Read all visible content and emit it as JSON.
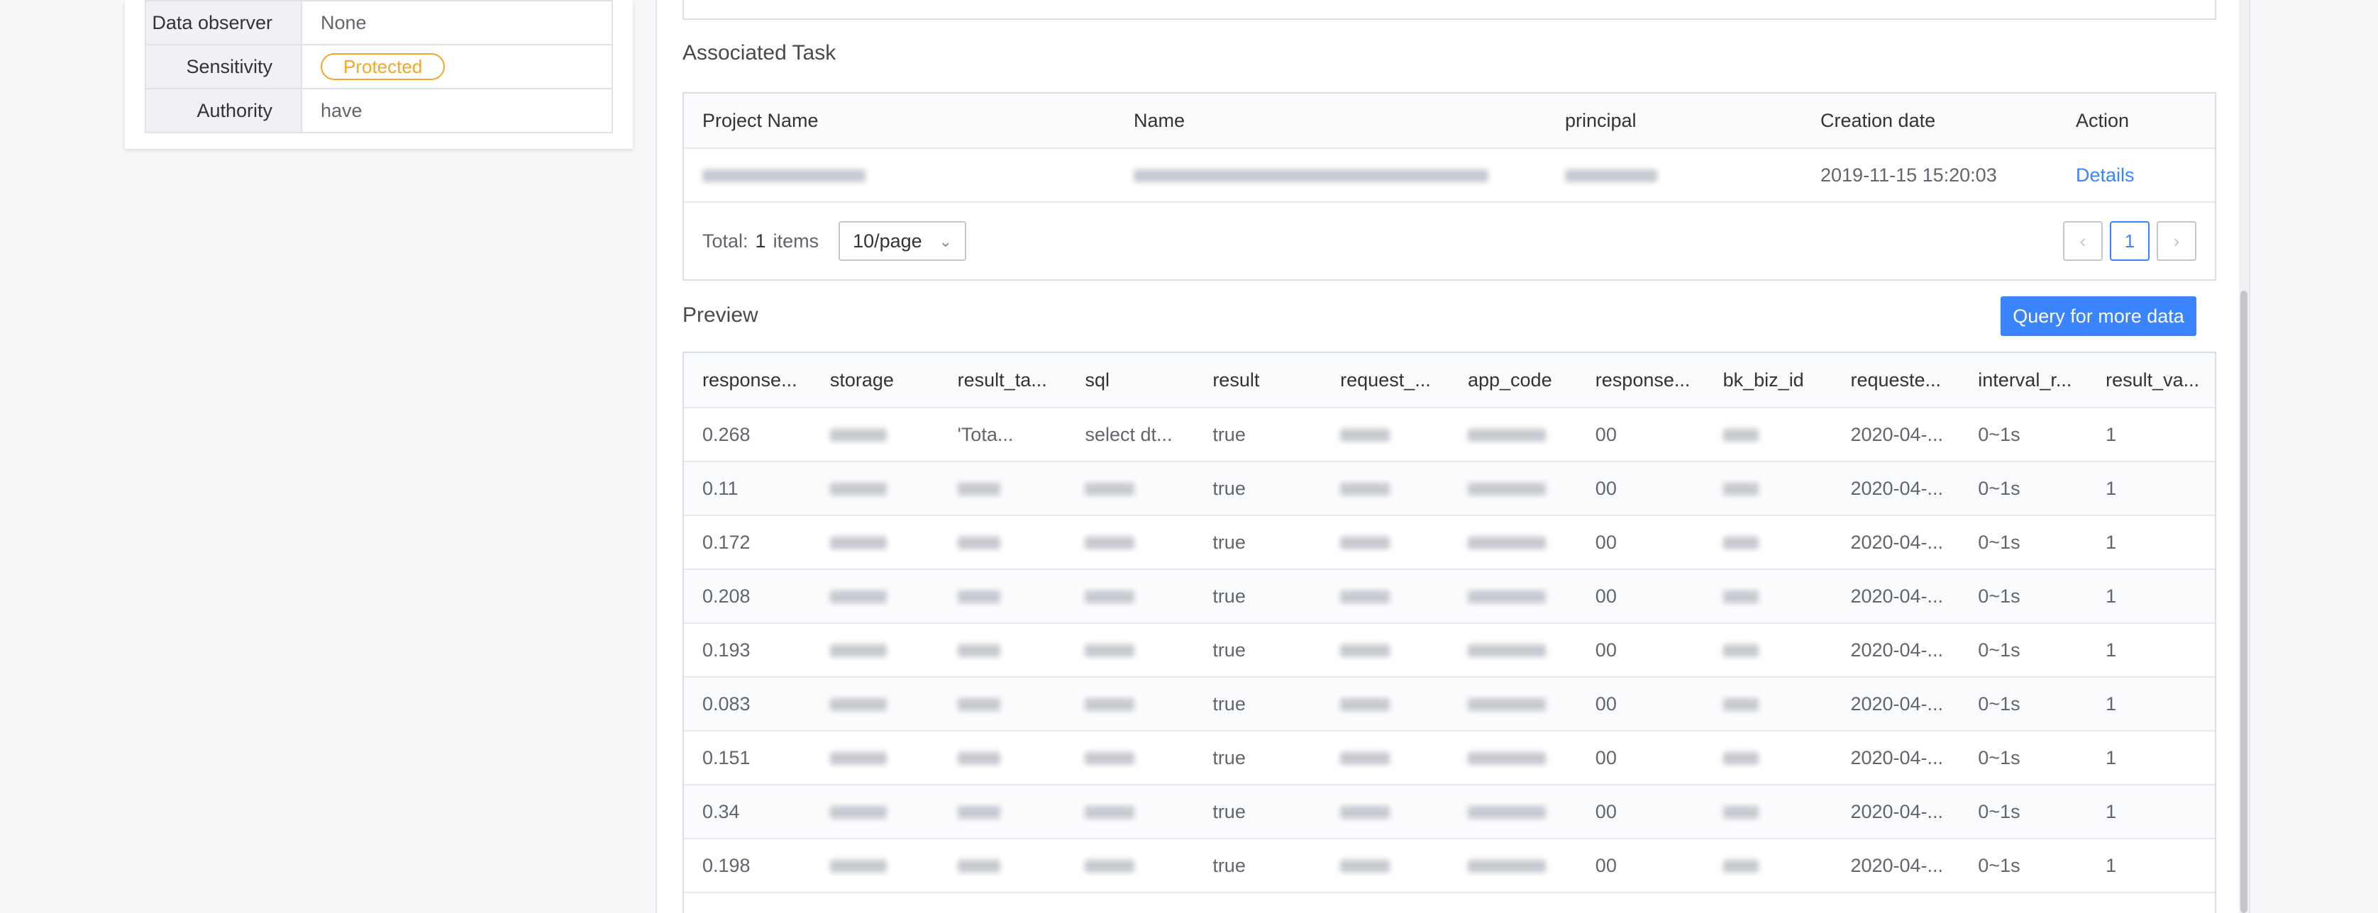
{
  "info": {
    "rows": [
      {
        "key": "Data observer",
        "value": "None"
      },
      {
        "key": "Sensitivity",
        "value": "Protected"
      },
      {
        "key": "Authority",
        "value": "have"
      }
    ]
  },
  "task": {
    "title": "Associated Task",
    "headers": [
      "Project Name",
      "Name",
      "principal",
      "Creation date",
      "Action"
    ],
    "row": {
      "project": "",
      "name": "",
      "principal": "",
      "created": "2019-11-15 15:20:03",
      "action": "Details"
    },
    "total_label": "Total:",
    "total_count": "1",
    "items_label": "items",
    "page_size": "10/page",
    "current_page": "1"
  },
  "preview": {
    "title": "Preview",
    "query_button": "Query for more data",
    "headers": [
      "response...",
      "storage",
      "result_ta...",
      "sql",
      "result",
      "request_...",
      "app_code",
      "response...",
      "bk_biz_id",
      "requeste...",
      "interval_r...",
      "result_va..."
    ],
    "rows": [
      [
        "0.268",
        "",
        "'Tota...",
        "select dt...",
        "true",
        "",
        "",
        "00",
        "",
        "2020-04-...",
        "0~1s",
        "1"
      ],
      [
        "0.11",
        "",
        "",
        "",
        "true",
        "",
        "",
        "00",
        "",
        "2020-04-...",
        "0~1s",
        "1"
      ],
      [
        "0.172",
        "",
        "",
        "",
        "true",
        "",
        "",
        "00",
        "",
        "2020-04-...",
        "0~1s",
        "1"
      ],
      [
        "0.208",
        "",
        "",
        "",
        "true",
        "",
        "",
        "00",
        "",
        "2020-04-...",
        "0~1s",
        "1"
      ],
      [
        "0.193",
        "",
        "",
        "",
        "true",
        "",
        "",
        "00",
        "",
        "2020-04-...",
        "0~1s",
        "1"
      ],
      [
        "0.083",
        "",
        "",
        "",
        "true",
        "",
        "",
        "00",
        "",
        "2020-04-...",
        "0~1s",
        "1"
      ],
      [
        "0.151",
        "",
        "",
        "",
        "true",
        "",
        "",
        "00",
        "",
        "2020-04-...",
        "0~1s",
        "1"
      ],
      [
        "0.34",
        "",
        "",
        "",
        "true",
        "",
        "",
        "00",
        "",
        "2020-04-...",
        "0~1s",
        "1"
      ],
      [
        "0.198",
        "",
        "",
        "",
        "true",
        "",
        "",
        "00",
        "",
        "2020-04-...",
        "0~1s",
        "1"
      ]
    ]
  },
  "icons": {
    "chevron": "chevron-down-icon",
    "prev": "chevron-left-icon",
    "next": "chevron-right-icon"
  },
  "colors": {
    "accent": "#3a84ff",
    "warning": "#f5a623",
    "success": "#2dcb56"
  }
}
